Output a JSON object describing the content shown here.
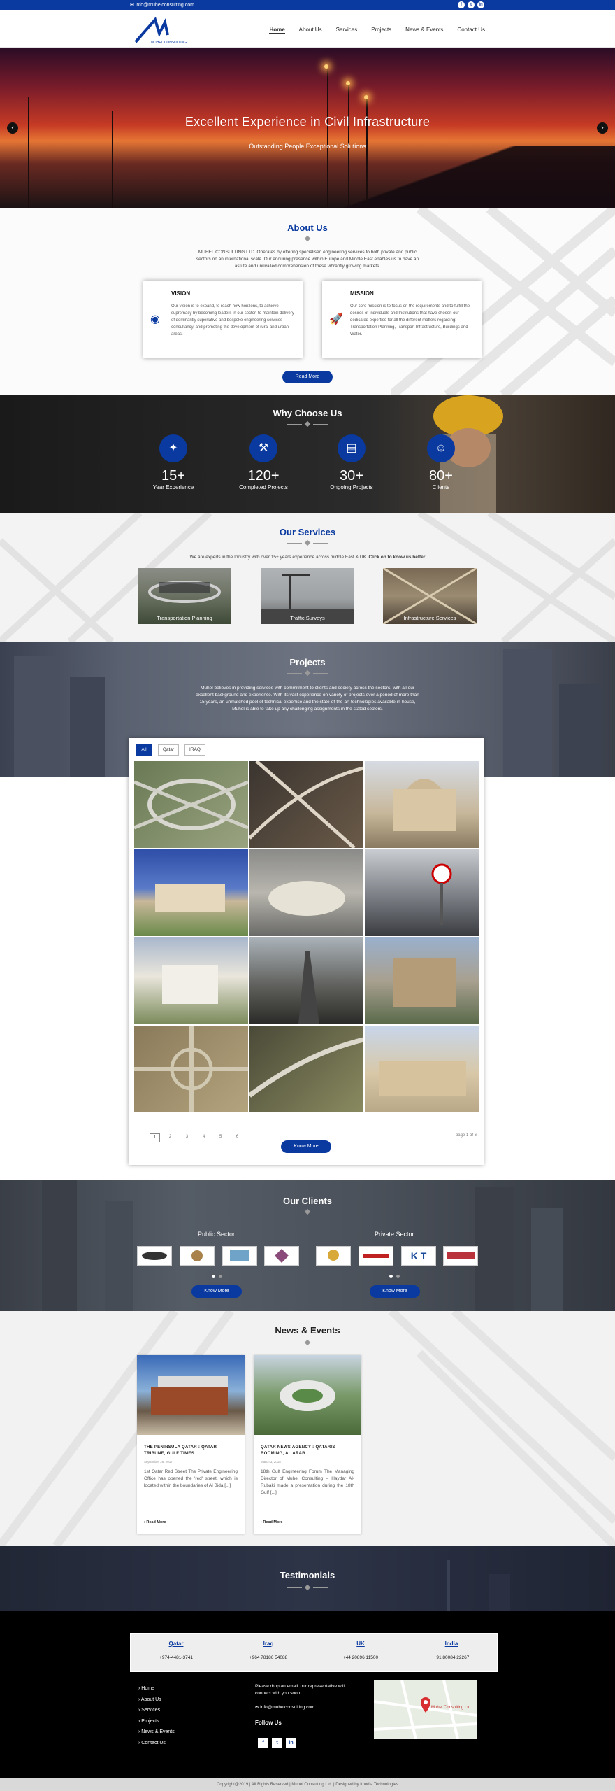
{
  "topbar": {
    "email": "info@muhelconsulting.com",
    "social": [
      "facebook-icon",
      "twitter-icon",
      "linkedin-icon"
    ]
  },
  "brand": {
    "logo_text": "MUHEL CONSULTING LTD"
  },
  "nav": {
    "items": [
      "Home",
      "About Us",
      "Services",
      "Projects",
      "News & Events",
      "Contact Us"
    ],
    "active": "Home"
  },
  "hero": {
    "title": "Excellent Experience in Civil Infrastructure",
    "subtitle": "Outstanding People Exceptional Solutions",
    "prev": "‹",
    "next": "›"
  },
  "about": {
    "title": "About Us",
    "description": "MUHEL CONSULTING LTD. Operates by offering specialised engineering services to both private and public sectors on an international scale. Our enduring presence within Europe and Middle East enables us to have an astute and unrivalled comprehension of these vibrantly growing markets.",
    "vision": {
      "title": "VISION",
      "text": "Our vision is to expand, to reach new horizons, to achieve supremacy by becoming leaders in our sector, to maintain delivery of dominantly superlative and bespoke engineering services consultancy, and promoting the development of rural and urban areas."
    },
    "mission": {
      "title": "MISSION",
      "text": "Our core mission is to focus on the requirements and to fulfill the desires of Individuals and Institutions that have chosen our dedicated expertise for all the different matters regarding: Transportation Planning, Transport Infrastructure, Buildings and Water."
    },
    "read_more": "Read More"
  },
  "why": {
    "title": "Why Choose Us",
    "stats": [
      {
        "value": "15+",
        "label": "Year Experience",
        "icon": "experience-icon"
      },
      {
        "value": "120+",
        "label": "Completed Projects",
        "icon": "crane-icon"
      },
      {
        "value": "30+",
        "label": "Ongoing Projects",
        "icon": "building-icon"
      },
      {
        "value": "80+",
        "label": "Clients",
        "icon": "user-icon"
      }
    ]
  },
  "services": {
    "title": "Our Services",
    "subtitle_plain": "We are experts in the Industry with over 15+ years experience across middle East & UK.",
    "subtitle_bold": "Click on to know us better",
    "items": [
      "Transportation Planning",
      "Traffic Surveys",
      "Infrastructure Services"
    ]
  },
  "projects": {
    "title": "Projects",
    "description": "Muhel believes in providing services with commitment to clients and society across the sectors, with all our excellent background and experience. With its vast experience on variety of projects over a period of more than 15 years, an unmatched pool of technical expertise and the state-of-the-art technologies available in-house, Muhel is able to take up any challenging assignments in the stated sectors.",
    "filters": [
      "All",
      "Qatar",
      "IRAQ"
    ],
    "active_filter": "All",
    "pages": [
      "1",
      "2",
      "3",
      "4",
      "5",
      "6"
    ],
    "current_page": "1",
    "page_info": "page 1 of 6",
    "know_more": "Know More"
  },
  "clients": {
    "title": "Our Clients",
    "public_label": "Public Sector",
    "private_label": "Private Sector",
    "know_more": "Know More",
    "public_logos": [
      "client-logo-1",
      "client-logo-2",
      "client-logo-3",
      "client-logo-4"
    ],
    "private_logos": [
      "client-logo-5",
      "client-logo-6",
      "client-logo-7",
      "client-logo-8"
    ],
    "private_logo_text": [
      "",
      "",
      "K T",
      ""
    ]
  },
  "news": {
    "title": "News & Events",
    "items": [
      {
        "title": "THE PENINSULA QATAR : QATAR TRIBUNE, GULF TIMES",
        "date": "September 26, 2017",
        "body": "1st Qatar Red Street The Private Engineering Office has opened the 'red' street, which is located within the boundaries of Al Bida [...]",
        "more": "Read More"
      },
      {
        "title": "QATAR NEWS AGENCY : QATARIS BOOMING, AL ARAB",
        "date": "March 3, 2018",
        "body": "18th Gulf Engineering Forum The Managing Director of Muhel Consulting – Haydar Al-Rubaki made a presentation during the 18th Gulf [...]",
        "more": "Read More"
      }
    ]
  },
  "testimonials": {
    "title": "Testimonials"
  },
  "footer": {
    "contacts": [
      {
        "country": "Qatar",
        "phone": "+974-4481-3741"
      },
      {
        "country": "Iraq",
        "phone": "+964 78186 54088"
      },
      {
        "country": "UK",
        "phone": "+44 20896 11500"
      },
      {
        "country": "India",
        "phone": "+91 80084 22267"
      }
    ],
    "links": [
      "Home",
      "About Us",
      "Services",
      "Projects",
      "News & Events",
      "Contact Us"
    ],
    "email_prompt": "Please drop an email. our representative will connect with you soon.",
    "email": "info@muhelconsulting.com",
    "follow": "Follow Us",
    "social": [
      "facebook-icon",
      "twitter-icon",
      "linkedin-icon"
    ],
    "map_label": "Muhel Consulting Ltd",
    "copyright": "Copyright@2019 | All Rights Reserved | Muhel Consulting Ltd. | Designed by Ithodia Technologies"
  },
  "colors": {
    "accent": "#0a3aa0",
    "dark": "#000000"
  }
}
